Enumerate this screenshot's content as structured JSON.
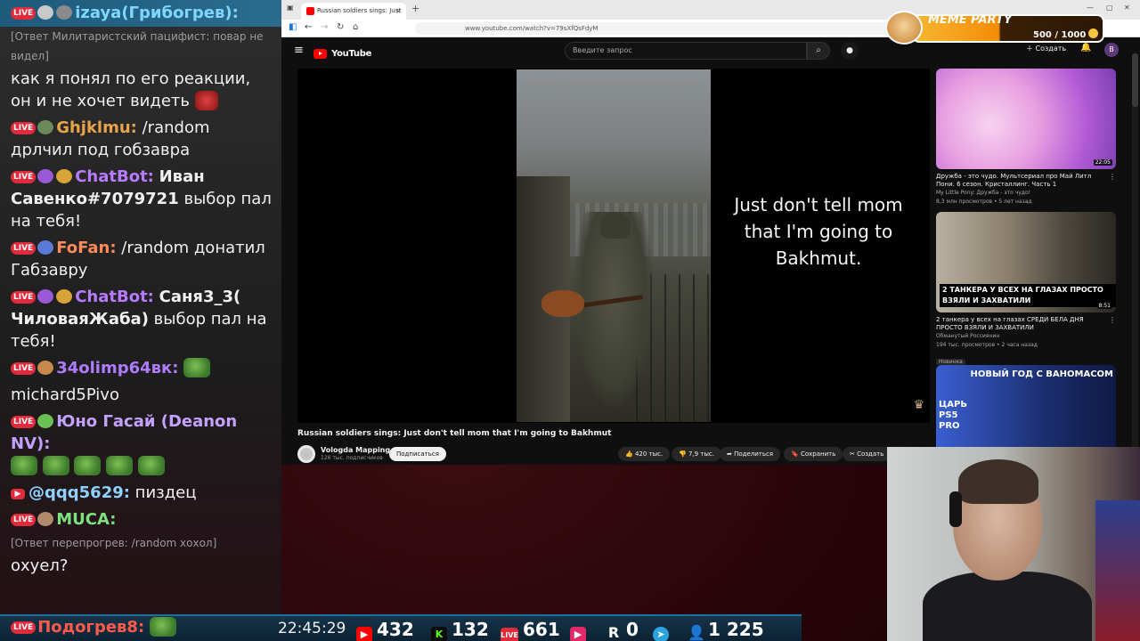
{
  "chat": {
    "messages": [
      {
        "nick": "izaya(Грибогрев):",
        "nick_color": "#7fd6ff",
        "text": "",
        "live": true
      },
      {
        "reply": "[Ответ Милитаристский пацифист: повар не видел]"
      },
      {
        "nick": "",
        "text": "как я понял по его реакции, он и не хочет видеть"
      },
      {
        "nick": "Ghjklmu:",
        "nick_color": "#e8a24a",
        "text": "/random дрлчил под гобзавра",
        "live": true
      },
      {
        "nick": "ChatBot:",
        "nick_color": "#b87aff",
        "text_bold": "Иван Савенко#7079721",
        "text": " выбор пал на тебя!",
        "live": true
      },
      {
        "nick": "FoFan:",
        "nick_color": "#ff8a5a",
        "text": " /random донатил Габзавру",
        "live": true
      },
      {
        "nick": "ChatBot:",
        "nick_color": "#b87aff",
        "text_bold": "Саня3_3( ЧиловаяЖаба)",
        "text": " выбор пал на тебя!",
        "live": true
      },
      {
        "nick": "34olimp64вк:",
        "nick_color": "#b07cff",
        "text": "",
        "live": true
      },
      {
        "nick": "",
        "text": "michard5Pivo"
      },
      {
        "nick": "Юно Гасай (Deanon NV):",
        "nick_color": "#c4a0ff",
        "text": "",
        "live": true
      },
      {
        "nick": "@qqq5629:",
        "nick_color": "#8fd0ff",
        "text": " пиздец",
        "youtube": true
      },
      {
        "nick": "MUCA:",
        "nick_color": "#7fe07f",
        "text": "",
        "live": true
      },
      {
        "reply": "[Ответ перепрогрев: /random хохол]"
      },
      {
        "nick": "",
        "text": "охуел?"
      }
    ],
    "live_badge": "LIVE"
  },
  "browser": {
    "tab_title": "Russian soldiers sings: Just",
    "url": "www.youtube.com/watch?v=79sXfQsFdyM",
    "search_placeholder": "Введите запрос",
    "logo_text": "YouTube",
    "create_label": "Создать",
    "user_initial": "В"
  },
  "video": {
    "subtitle": "Just don't tell mom that I'm going to Bakhmut.",
    "title": "Russian soldiers sings: Just don't tell mom that I'm going to Bakhmut",
    "channel": "Vologda Mapping",
    "subscribers": "126 тыс. подписчиков",
    "subscribe_label": "Подписаться",
    "likes": "420 тыс.",
    "dislikes": "7,9 тыс.",
    "share_label": "Поделиться",
    "save_label": "Сохранить",
    "clip_label": "Создать"
  },
  "recommendations": [
    {
      "title": "Дружба - это чудо. Мультсериал про Май Литл Пони. 6 сезон. Кристаллинг. Часть 1",
      "channel": "My Little Pony: Дружба - это чудо!",
      "meta": "8,3 млн просмотров • 5 лет назад",
      "duration": "22:05",
      "caption": "",
      "badge": ""
    },
    {
      "title": "2 танкера у всех на глазах СРЕДИ БЕЛА ДНЯ ПРОСТО ВЗЯЛИ И ЗАХВАТИЛИ",
      "channel": "Обманутый Россиянин",
      "meta": "194 тыс. просмотров • 2 часа назад",
      "duration": "8:51",
      "caption": "2 ТАНКЕРА У ВСЕХ НА ГЛАЗАХ ПРОСТО ВЗЯЛИ И ЗАХВАТИЛИ",
      "badge": "Новинка"
    },
    {
      "title": "",
      "channel": "",
      "meta": "",
      "duration": "",
      "caption": "НОВЫЙ ГОД С ВАНОМАСОМ",
      "badge": ""
    }
  ],
  "third_thumb_text": "ЦАРЬ PS5 PRO",
  "meme_party": {
    "title": "MEME PARTY",
    "score": "500 / 1000"
  },
  "statusbar": {
    "bottom_nick": "Подогрев8:",
    "clock": "22:45:29",
    "youtube_count": "432",
    "kick_count": "132",
    "live_count": "661",
    "r_count": "0",
    "viewers": "1 225"
  },
  "colors": {
    "accent_red": "#e12a3b",
    "youtube_red": "#ff0000",
    "kick_green": "#53fc18"
  }
}
